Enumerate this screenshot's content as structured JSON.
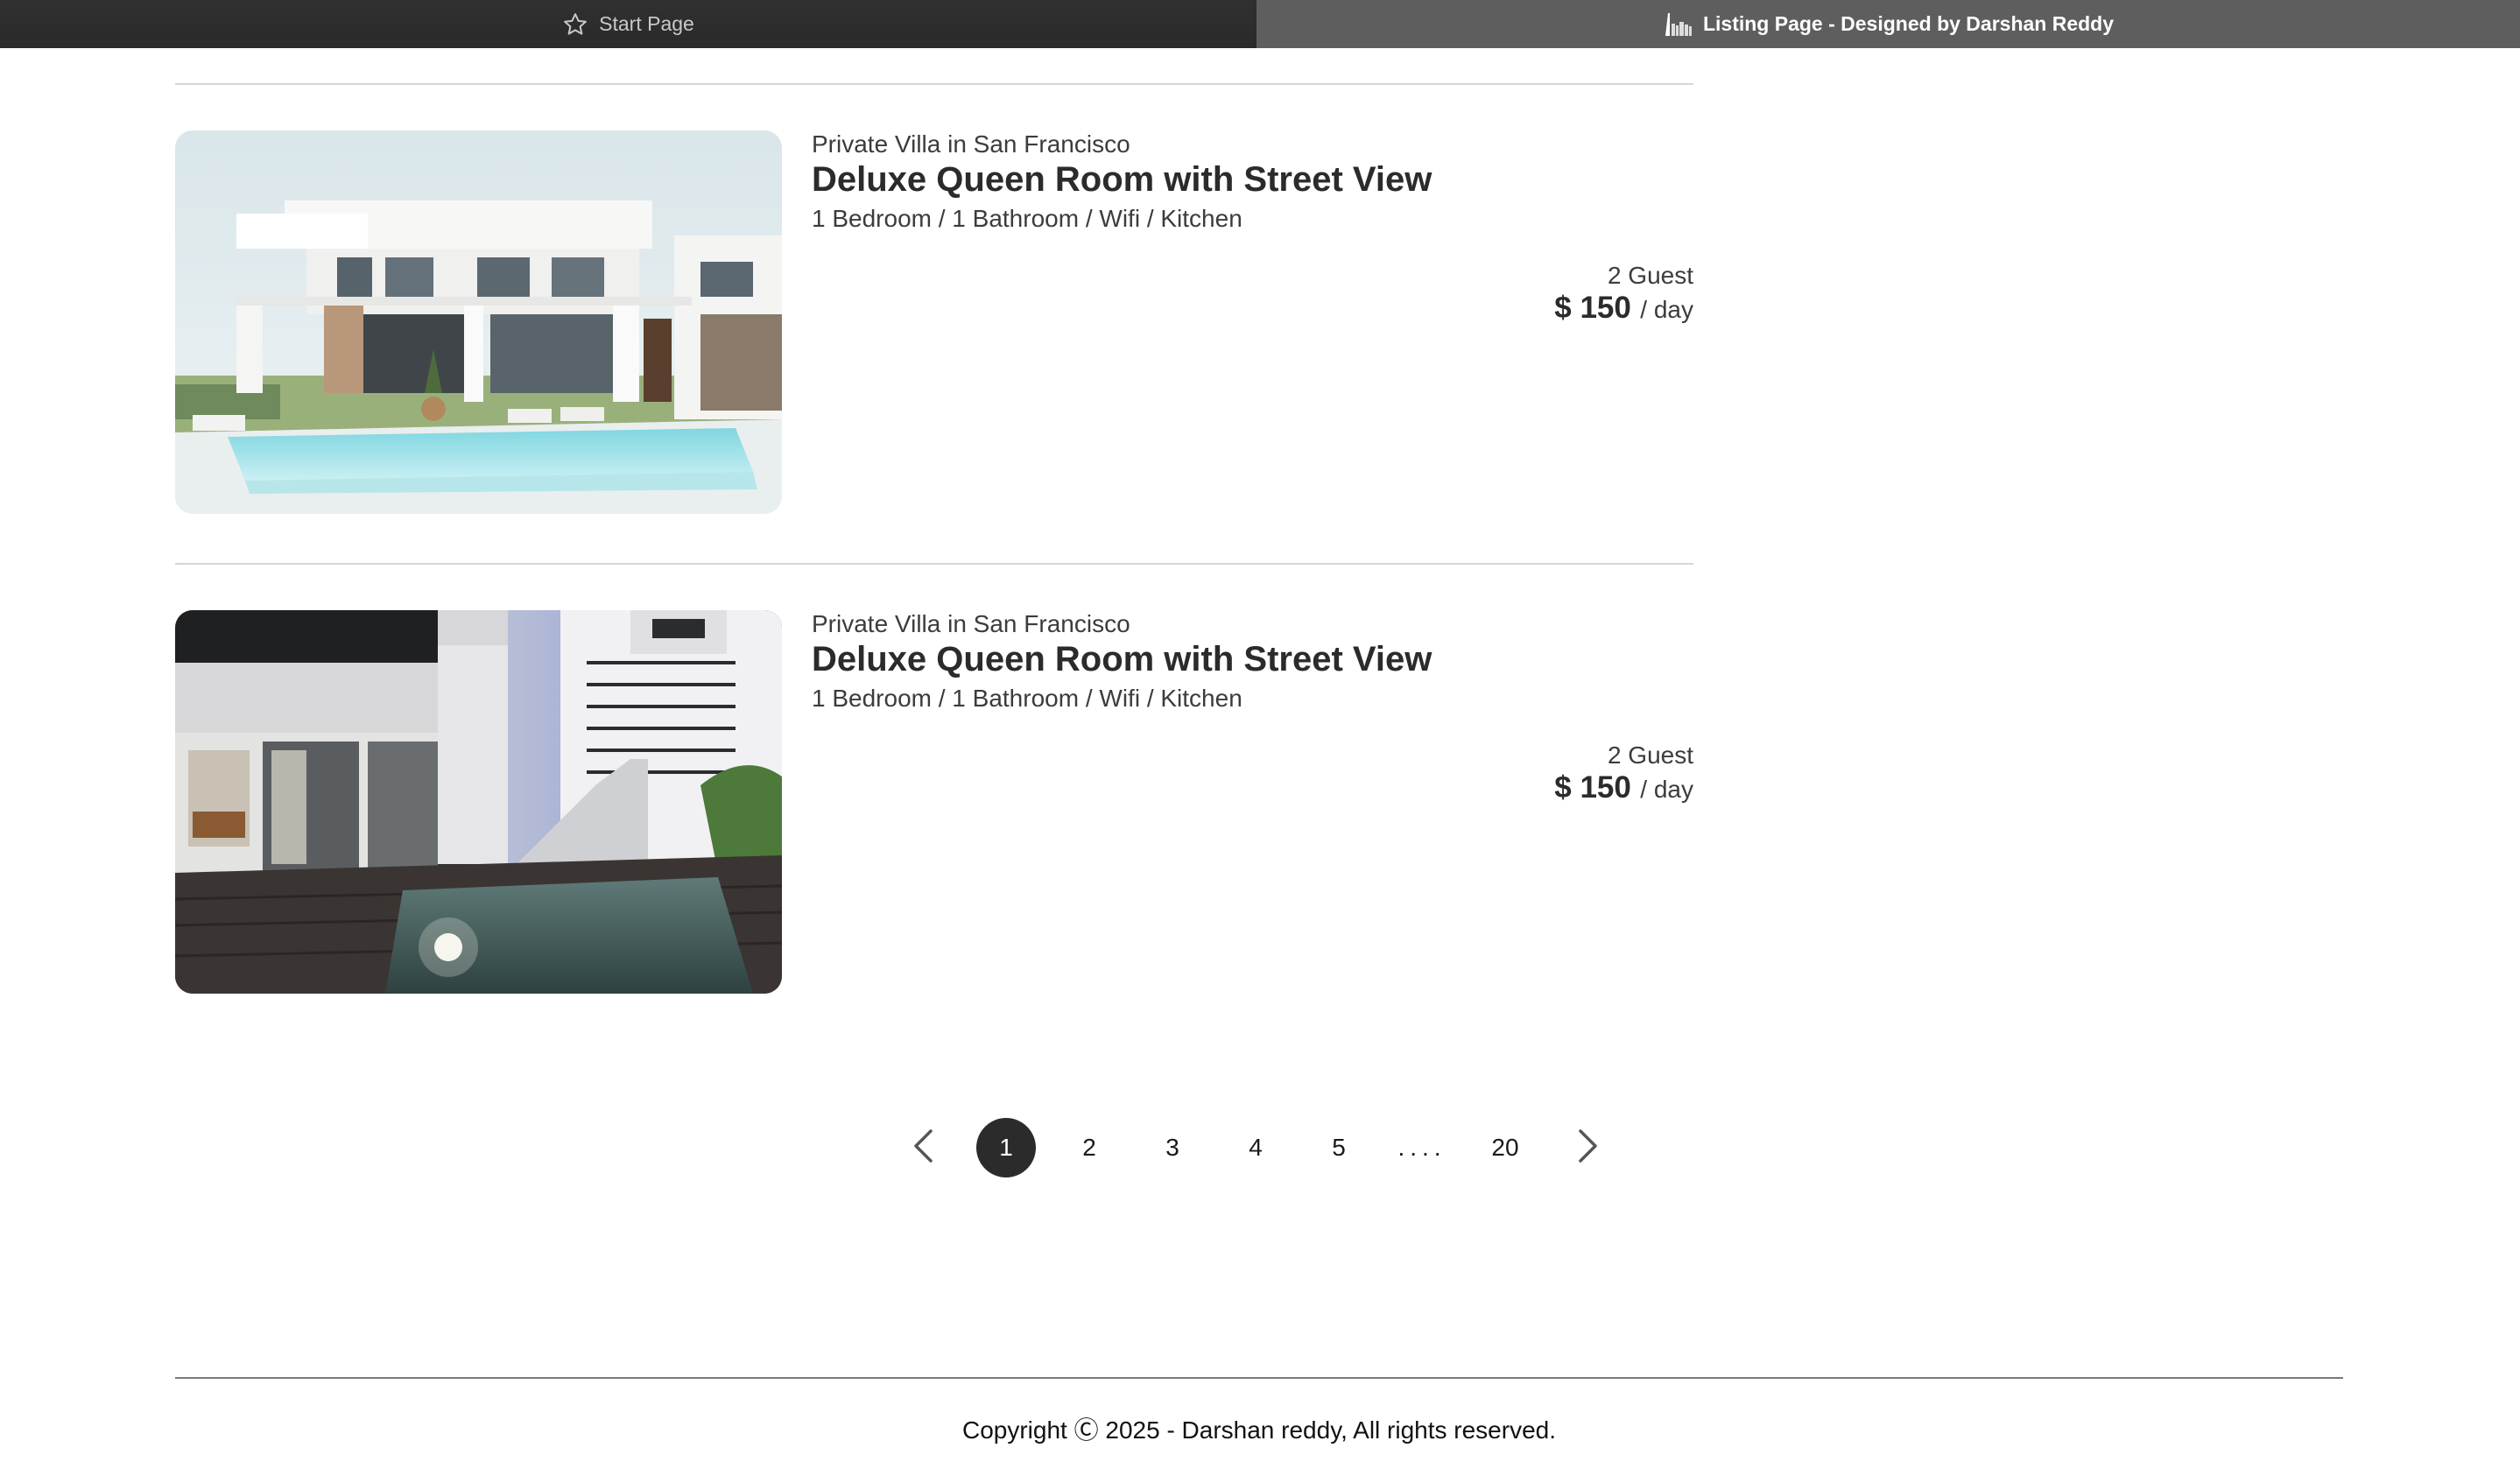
{
  "tabs": [
    {
      "label": "Start Page",
      "icon": "star-icon",
      "active": false
    },
    {
      "label": "Listing Page - Designed by Darshan Reddy",
      "icon": "page-favicon-icon",
      "active": true
    }
  ],
  "listings": [
    {
      "subtitle": "Private Villa in San Francisco",
      "title": "Deluxe Queen Room with Street View",
      "features": "1 Bedroom / 1 Bathroom / Wifi / Kitchen",
      "guests": "2 Guest",
      "price": "$ 150",
      "price_unit": "/ day",
      "image": "modern-white-villa-with-pool"
    },
    {
      "subtitle": "Private Villa in San Francisco",
      "title": "Deluxe Queen Room with Street View",
      "features": "1 Bedroom / 1 Bathroom / Wifi / Kitchen",
      "guests": "2 Guest",
      "price": "$ 150",
      "price_unit": "/ day",
      "image": "villa-courtyard-with-plunge-pool"
    }
  ],
  "pagination": {
    "prev_icon": "chevron-left-icon",
    "next_icon": "chevron-right-icon",
    "pages": [
      "1",
      "2",
      "3",
      "4",
      "5"
    ],
    "ellipsis": "....",
    "last": "20",
    "current": "1"
  },
  "footer": {
    "copyright": "Copyright Ⓒ 2025 - Darshan reddy, All rights reserved."
  },
  "colors": {
    "accent": "#2b2b2b",
    "tab_active_bg": "#5e5e5e",
    "tab_inactive_bg": "#2c2c2c"
  }
}
